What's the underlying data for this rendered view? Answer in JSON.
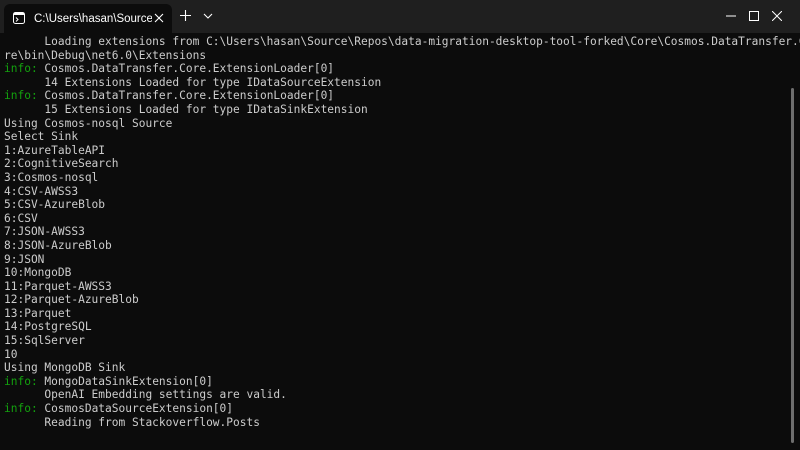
{
  "window": {
    "tab_title": "C:\\Users\\hasan\\Source\\Repos",
    "icons": {
      "tab": "terminal-icon",
      "tab_close": "close-icon",
      "new_tab": "plus-icon",
      "dropdown": "chevron-down-icon",
      "minimize": "minimize-icon",
      "maximize": "maximize-icon",
      "close": "close-icon"
    }
  },
  "colors": {
    "background": "#0c0c0c",
    "titlebar": "#1f1f1f",
    "text": "#cccccc",
    "info": "#13a10e"
  },
  "terminal": {
    "lines": [
      {
        "prefix": "",
        "text": "      Loading extensions from C:\\Users\\hasan\\Source\\Repos\\data-migration-desktop-tool-forked\\Core\\Cosmos.DataTransfer.Co"
      },
      {
        "prefix": "",
        "text": "re\\bin\\Debug\\net6.0\\Extensions"
      },
      {
        "prefix": "info: ",
        "text": "Cosmos.DataTransfer.Core.ExtensionLoader[0]"
      },
      {
        "prefix": "",
        "text": "      14 Extensions Loaded for type IDataSourceExtension"
      },
      {
        "prefix": "info: ",
        "text": "Cosmos.DataTransfer.Core.ExtensionLoader[0]"
      },
      {
        "prefix": "",
        "text": "      15 Extensions Loaded for type IDataSinkExtension"
      },
      {
        "prefix": "",
        "text": "Using Cosmos-nosql Source"
      },
      {
        "prefix": "",
        "text": "Select Sink"
      },
      {
        "prefix": "",
        "text": "1:AzureTableAPI"
      },
      {
        "prefix": "",
        "text": "2:CognitiveSearch"
      },
      {
        "prefix": "",
        "text": "3:Cosmos-nosql"
      },
      {
        "prefix": "",
        "text": "4:CSV-AWSS3"
      },
      {
        "prefix": "",
        "text": "5:CSV-AzureBlob"
      },
      {
        "prefix": "",
        "text": "6:CSV"
      },
      {
        "prefix": "",
        "text": "7:JSON-AWSS3"
      },
      {
        "prefix": "",
        "text": "8:JSON-AzureBlob"
      },
      {
        "prefix": "",
        "text": "9:JSON"
      },
      {
        "prefix": "",
        "text": "10:MongoDB"
      },
      {
        "prefix": "",
        "text": "11:Parquet-AWSS3"
      },
      {
        "prefix": "",
        "text": "12:Parquet-AzureBlob"
      },
      {
        "prefix": "",
        "text": "13:Parquet"
      },
      {
        "prefix": "",
        "text": "14:PostgreSQL"
      },
      {
        "prefix": "",
        "text": "15:SqlServer"
      },
      {
        "prefix": "",
        "text": "10"
      },
      {
        "prefix": "",
        "text": "Using MongoDB Sink"
      },
      {
        "prefix": "info: ",
        "text": "MongoDataSinkExtension[0]"
      },
      {
        "prefix": "",
        "text": "      OpenAI Embedding settings are valid."
      },
      {
        "prefix": "info: ",
        "text": "CosmosDataSourceExtension[0]"
      },
      {
        "prefix": "",
        "text": "      Reading from Stackoverflow.Posts"
      }
    ]
  }
}
